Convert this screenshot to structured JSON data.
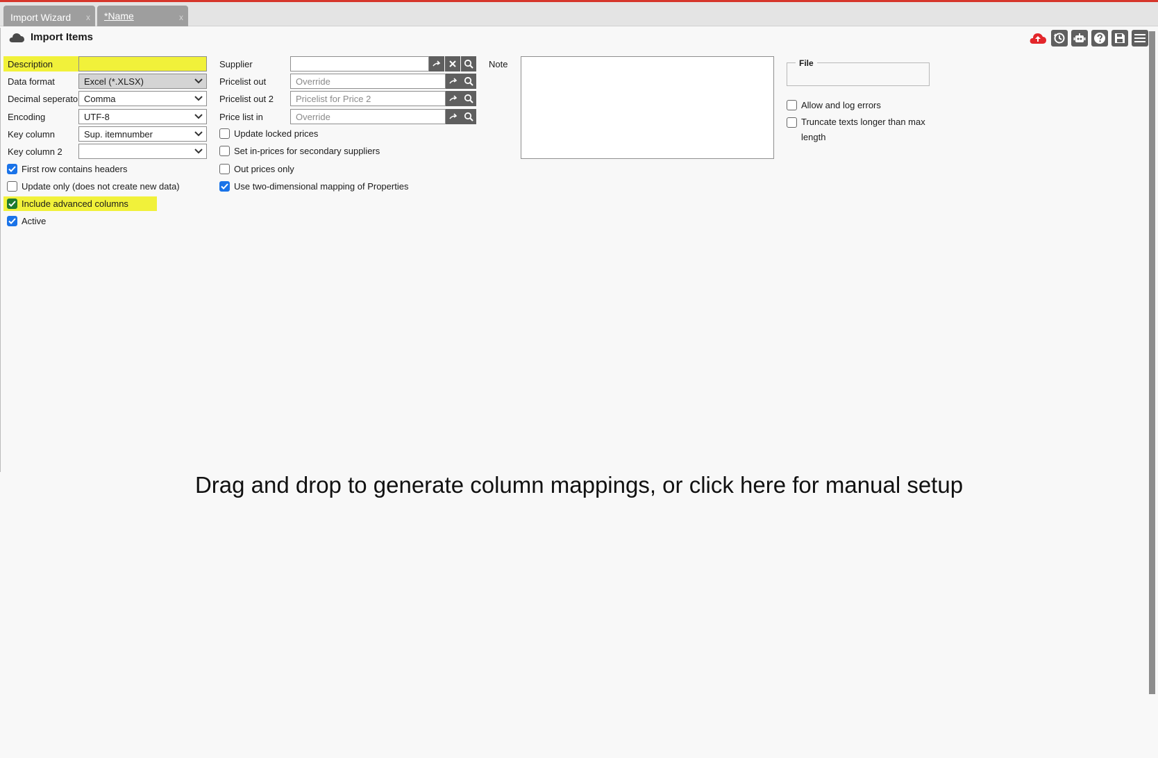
{
  "tabs": [
    {
      "label": "Import Wizard",
      "close": "x"
    },
    {
      "label": "*Name",
      "close": "x"
    }
  ],
  "header": {
    "title": "Import Items",
    "icon": "cloud-icon"
  },
  "toolbar": {
    "icons": [
      "cloud-upload-icon",
      "history-icon",
      "robot-icon",
      "help-icon",
      "save-icon",
      "menu-icon"
    ],
    "colors": {
      "upload": "#e3262b",
      "button": "#5f5f5f"
    }
  },
  "form": {
    "description": {
      "label": "Description",
      "value": ""
    },
    "data_format": {
      "label": "Data format",
      "value": "Excel (*.XLSX)"
    },
    "decimal_separator": {
      "label": "Decimal seperator",
      "value": "Comma"
    },
    "encoding": {
      "label": "Encoding",
      "value": "UTF-8"
    },
    "key_column": {
      "label": "Key column",
      "value": "Sup. itemnumber"
    },
    "key_column_2": {
      "label": "Key column 2",
      "value": ""
    },
    "checks": [
      {
        "label": "First row contains headers",
        "checked": true
      },
      {
        "label": "Update only (does not create new data)",
        "checked": false
      },
      {
        "label": "Include advanced columns",
        "checked": true
      },
      {
        "label": "Active",
        "checked": true
      }
    ]
  },
  "middle": {
    "supplier": {
      "label": "Supplier",
      "value": ""
    },
    "pricelist_out": {
      "label": "Pricelist out",
      "placeholder": "Override"
    },
    "pricelist_out_2": {
      "label": "Pricelist out 2",
      "placeholder": "Pricelist for Price 2"
    },
    "price_list_in": {
      "label": "Price list in",
      "placeholder": "Override"
    },
    "checks": [
      {
        "label": "Update locked prices",
        "checked": false
      },
      {
        "label": "Set in-prices for secondary suppliers",
        "checked": false
      },
      {
        "label": "Out prices only",
        "checked": false
      },
      {
        "label": "Use two-dimensional mapping of Properties",
        "checked": true
      }
    ]
  },
  "note": {
    "label": "Note",
    "value": ""
  },
  "file": {
    "legend": "File",
    "checks": [
      {
        "label": "Allow and log errors",
        "checked": false
      },
      {
        "label": "Truncate texts longer than max length",
        "checked": false
      }
    ]
  },
  "dropzone": {
    "text": "Drag and drop to generate column mappings, or click here for manual setup"
  },
  "colors": {
    "highlight": "#f1f13a",
    "checkbox": "#1a73e8",
    "tab": "#9e9e9e",
    "accent_line": "#d6362b"
  }
}
